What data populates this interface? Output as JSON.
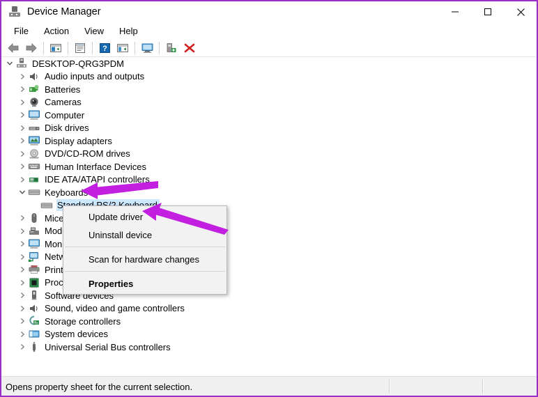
{
  "window": {
    "title": "Device Manager",
    "title_icon": "device-manager-icon",
    "border_color": "#9b30c9",
    "controls": {
      "minimize": "minimize-icon",
      "maximize": "maximize-icon",
      "close": "close-icon"
    }
  },
  "menubar": {
    "items": [
      {
        "label": "File"
      },
      {
        "label": "Action"
      },
      {
        "label": "View"
      },
      {
        "label": "Help"
      }
    ]
  },
  "toolbar": {
    "buttons": [
      {
        "name": "back-icon"
      },
      {
        "name": "forward-icon"
      },
      {
        "name": "separator"
      },
      {
        "name": "show-hide-console-tree-icon"
      },
      {
        "name": "separator"
      },
      {
        "name": "properties-icon"
      },
      {
        "name": "separator"
      },
      {
        "name": "help-icon"
      },
      {
        "name": "update-driver-icon"
      },
      {
        "name": "separator"
      },
      {
        "name": "scan-hardware-changes-icon"
      },
      {
        "name": "separator"
      },
      {
        "name": "add-legacy-hardware-icon"
      },
      {
        "name": "uninstall-device-icon"
      }
    ]
  },
  "tree": {
    "root": {
      "label": "DESKTOP-QRG3PDM",
      "expanded": true,
      "icon": "computer-node-icon"
    },
    "items": [
      {
        "label": "Audio inputs and outputs",
        "icon": "speaker-icon",
        "expanded": false,
        "selected": false
      },
      {
        "label": "Batteries",
        "icon": "battery-icon",
        "expanded": false,
        "selected": false
      },
      {
        "label": "Cameras",
        "icon": "camera-icon",
        "expanded": false,
        "selected": false
      },
      {
        "label": "Computer",
        "icon": "monitor-icon",
        "expanded": false,
        "selected": false
      },
      {
        "label": "Disk drives",
        "icon": "disk-drive-icon",
        "expanded": false,
        "selected": false
      },
      {
        "label": "Display adapters",
        "icon": "display-adapter-icon",
        "expanded": false,
        "selected": false
      },
      {
        "label": "DVD/CD-ROM drives",
        "icon": "dvd-drive-icon",
        "expanded": false,
        "selected": false
      },
      {
        "label": "Human Interface Devices",
        "icon": "hid-icon",
        "expanded": false,
        "selected": false
      },
      {
        "label": "IDE ATA/ATAPI controllers",
        "icon": "ide-controller-icon",
        "expanded": false,
        "selected": false
      },
      {
        "label": "Keyboards",
        "icon": "keyboard-icon",
        "expanded": true,
        "selected": false
      },
      {
        "label": "Standard PS/2 Keyboard",
        "icon": "keyboard-icon",
        "expanded": null,
        "selected": true,
        "child": true
      },
      {
        "label": "Mice and other pointing devices",
        "icon": "mouse-icon",
        "expanded": false,
        "selected": false
      },
      {
        "label": "Modems",
        "icon": "modem-icon",
        "expanded": false,
        "selected": false
      },
      {
        "label": "Monitors",
        "icon": "monitor-icon",
        "expanded": false,
        "selected": false
      },
      {
        "label": "Network adapters",
        "icon": "network-adapter-icon",
        "expanded": false,
        "selected": false
      },
      {
        "label": "Print queues",
        "icon": "printer-icon",
        "expanded": false,
        "selected": false
      },
      {
        "label": "Processors",
        "icon": "processor-icon",
        "expanded": false,
        "selected": false
      },
      {
        "label": "Software devices",
        "icon": "software-device-icon",
        "expanded": false,
        "selected": false
      },
      {
        "label": "Sound, video and game controllers",
        "icon": "speaker-icon",
        "expanded": false,
        "selected": false
      },
      {
        "label": "Storage controllers",
        "icon": "storage-controller-icon",
        "expanded": false,
        "selected": false
      },
      {
        "label": "System devices",
        "icon": "system-device-icon",
        "expanded": false,
        "selected": false
      },
      {
        "label": "Universal Serial Bus controllers",
        "icon": "usb-icon",
        "expanded": false,
        "selected": false
      }
    ]
  },
  "context_menu": {
    "items": [
      {
        "label": "Update driver",
        "bold": false,
        "type": "item"
      },
      {
        "label": "Uninstall device",
        "bold": false,
        "type": "item"
      },
      {
        "type": "separator"
      },
      {
        "label": "Scan for hardware changes",
        "bold": false,
        "type": "item"
      },
      {
        "type": "separator"
      },
      {
        "label": "Properties",
        "bold": true,
        "type": "item"
      }
    ]
  },
  "annotations": {
    "color": "#c21fe0",
    "arrows": [
      {
        "name": "arrow-to-keyboards",
        "points_to": "Keyboards"
      },
      {
        "name": "arrow-to-update-driver",
        "points_to": "Update driver"
      }
    ]
  },
  "statusbar": {
    "text": "Opens property sheet for the current selection."
  }
}
